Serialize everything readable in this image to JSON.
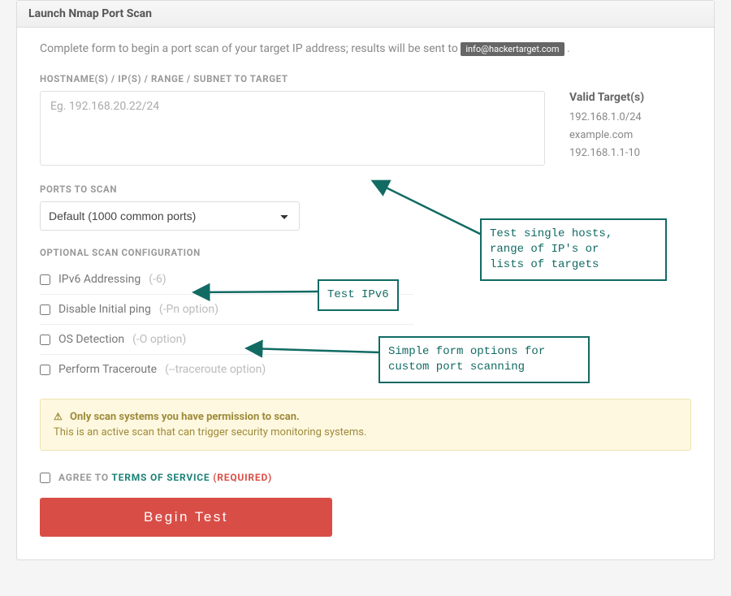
{
  "header": {
    "title": "Launch Nmap Port Scan"
  },
  "intro": {
    "text": "Complete form to begin a port scan of your target IP address; results will be sent to ",
    "email_badge": "info@hackertarget.com",
    "suffix": "."
  },
  "target": {
    "label": "HOSTNAME(S) / IP(S) / RANGE / SUBNET TO TARGET",
    "placeholder": "Eg. 192.168.20.22/24",
    "value": "",
    "valid_heading": "Valid Target(s)",
    "valid_examples": [
      "192.168.1.0/24",
      "example.com",
      "192.168.1.1-10"
    ]
  },
  "ports": {
    "label": "PORTS TO SCAN",
    "selected": "Default (1000 common ports)"
  },
  "options": {
    "label": "OPTIONAL SCAN CONFIGURATION",
    "items": [
      {
        "label": "IPv6 Addressing",
        "flag": "(-6)"
      },
      {
        "label": "Disable Initial ping",
        "flag": "(-Pn option)"
      },
      {
        "label": "OS Detection",
        "flag": "(-O option)"
      },
      {
        "label": "Perform Traceroute",
        "flag": "(--traceroute option)"
      }
    ]
  },
  "alert": {
    "title": "Only scan systems you have permission to scan.",
    "body": "This is an active scan that can trigger security monitoring systems."
  },
  "agree": {
    "prefix": "AGREE TO",
    "tos": "TERMS OF SERVICE",
    "required": "(REQUIRED)"
  },
  "submit": {
    "label": "Begin Test"
  },
  "annotations": {
    "targets": "Test single hosts,\nrange of IP's or\nlists of targets",
    "ipv6": "Test IPv6",
    "options": "Simple form options for\ncustom port scanning"
  }
}
